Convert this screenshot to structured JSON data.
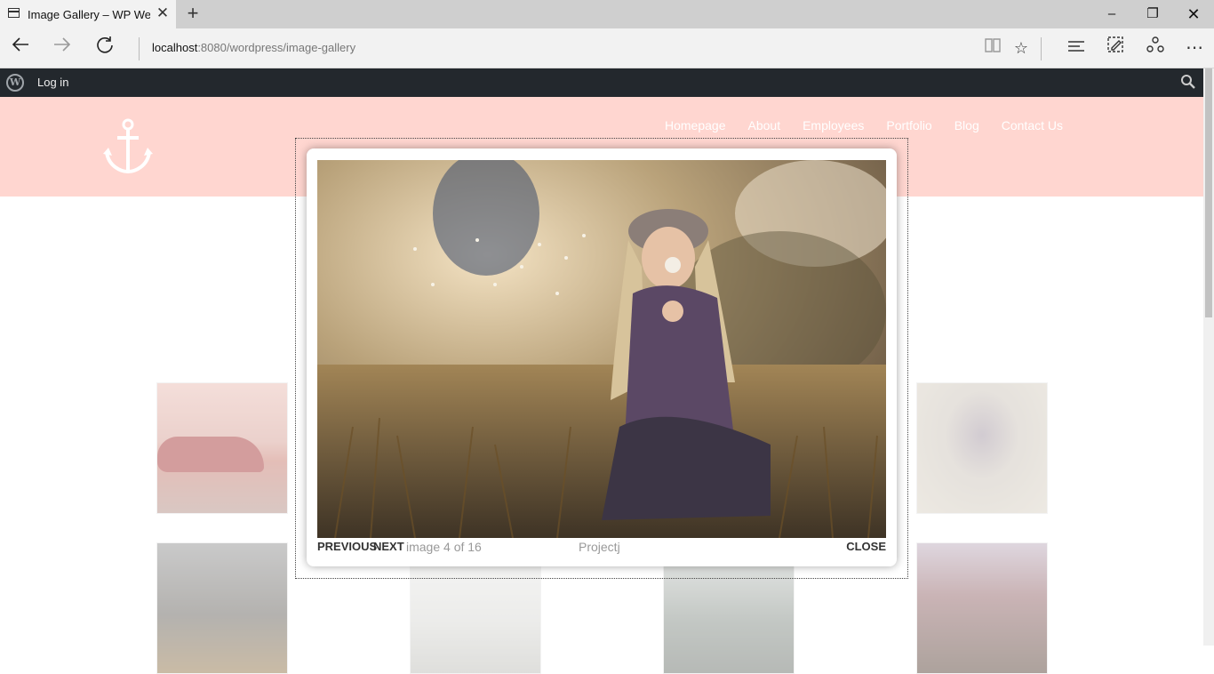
{
  "browser": {
    "tab_title": "Image Gallery – WP Wel",
    "url_host": "localhost",
    "url_rest": ":8080/wordpress/image-gallery",
    "icons": [
      "page-icon",
      "close-icon",
      "plus-icon",
      "back-icon",
      "forward-icon",
      "refresh-icon",
      "reading-view-icon",
      "star-icon",
      "hub-icon",
      "web-note-icon",
      "share-icon",
      "more-icon",
      "minimize-icon",
      "restore-icon",
      "close-window-icon"
    ]
  },
  "adminbar": {
    "login_label": "Log in",
    "icons": [
      "wordpress-logo-icon",
      "search-icon"
    ]
  },
  "header": {
    "logo_icon": "anchor-icon",
    "menu": [
      "Homepage",
      "About",
      "Employees",
      "Portfolio",
      "Blog",
      "Contact Us"
    ],
    "background": "#ffd6d0"
  },
  "lightbox": {
    "previous_label": "PREVIOUS",
    "next_label": "NEXT",
    "counter": "image 4 of 16",
    "title": "Projectj",
    "close_label": "CLOSE"
  }
}
